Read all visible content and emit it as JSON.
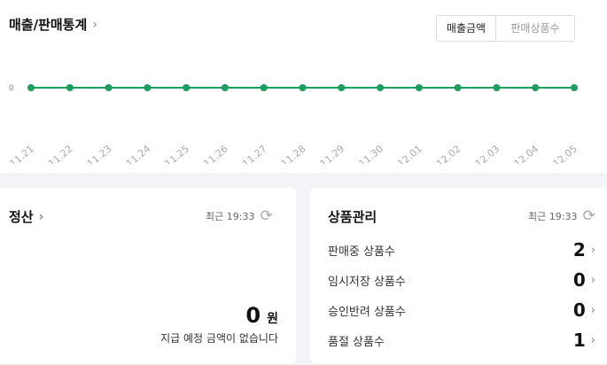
{
  "sales": {
    "title": "매출/판매통계",
    "toggle": [
      "매출금액",
      "판매상품수"
    ]
  },
  "chart_data": {
    "type": "line",
    "categories": [
      "11.21",
      "11.22",
      "11.23",
      "11.24",
      "11.25",
      "11.26",
      "11.27",
      "11.28",
      "11.29",
      "11.30",
      "12.01",
      "12.02",
      "12.03",
      "12.04",
      "12.05"
    ],
    "values": [
      0,
      0,
      0,
      0,
      0,
      0,
      0,
      0,
      0,
      0,
      0,
      0,
      0,
      0,
      0
    ],
    "yticks": [
      "0"
    ],
    "color": "#1aa05e"
  },
  "settlement": {
    "title": "정산",
    "updated": "최근 19:33",
    "amount": "0",
    "unit": "원",
    "note": "지급 예정 금액이 없습니다"
  },
  "products": {
    "title": "상품관리",
    "updated": "최근 19:33",
    "rows": [
      {
        "label": "판매중 상품수",
        "count": "2"
      },
      {
        "label": "임시저장 상품수",
        "count": "0"
      },
      {
        "label": "승인반려 상품수",
        "count": "0"
      },
      {
        "label": "품절 상품수",
        "count": "1"
      }
    ]
  }
}
